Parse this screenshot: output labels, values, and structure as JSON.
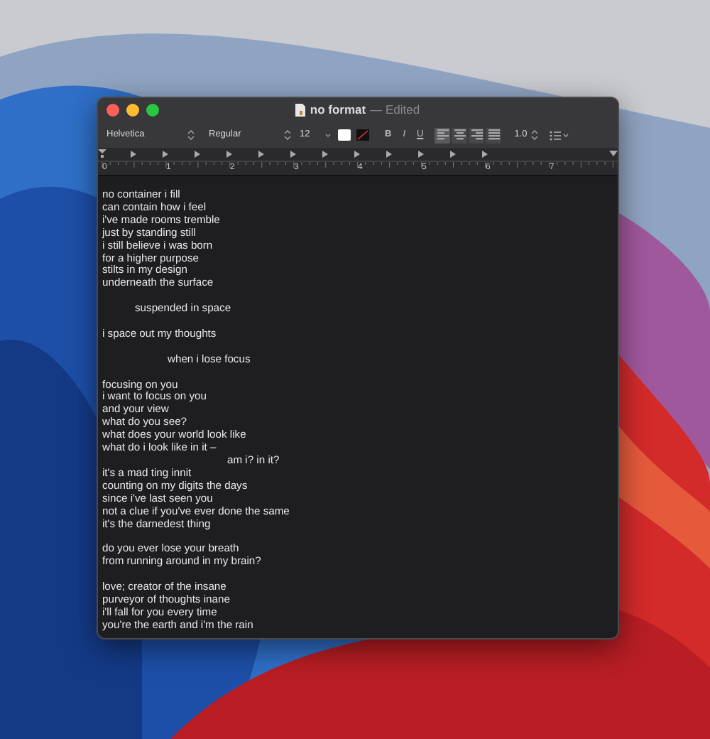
{
  "window": {
    "title": "no format",
    "status": "— Edited"
  },
  "toolbar": {
    "font": "Helvetica",
    "style": "Regular",
    "size": "12",
    "bold": "B",
    "italic": "I",
    "underline": "U",
    "alignments": [
      {
        "selected": true
      },
      {
        "selected": false
      },
      {
        "selected": false
      },
      {
        "selected": false
      }
    ],
    "spacing": "1.0"
  },
  "ruler": {
    "numbers": [
      "0",
      "1",
      "2",
      "3",
      "4",
      "5",
      "6",
      "7"
    ]
  },
  "document": {
    "stanzas": [
      {
        "lines": [
          {
            "text": "no container i fill",
            "kind": "flush"
          },
          {
            "text": "can contain how i feel",
            "kind": "flush"
          },
          {
            "text": "i've made rooms tremble",
            "kind": "flush"
          },
          {
            "text": "just by standing still",
            "kind": "flush"
          },
          {
            "text": "i still believe i was born",
            "kind": "flush"
          },
          {
            "text": "for a higher purpose",
            "kind": "flush"
          },
          {
            "text": "stilts in my design",
            "kind": "flush"
          },
          {
            "text": "underneath the surface",
            "kind": "flush"
          }
        ]
      },
      {
        "lines": [
          {
            "text": "suspended in space",
            "kind": "indent"
          }
        ]
      },
      {
        "lines": [
          {
            "text": "i space out my thoughts",
            "kind": "flush"
          }
        ]
      },
      {
        "lines": [
          {
            "text": "when i lose focus",
            "kind": "deep"
          }
        ]
      },
      {
        "lines": [
          {
            "text": "focusing on you",
            "kind": "flush"
          },
          {
            "text": "i want to focus on you",
            "kind": "flush"
          },
          {
            "text": "and your view",
            "kind": "flush"
          },
          {
            "text": "what do you see?",
            "kind": "flush"
          },
          {
            "text": "what does your world look like",
            "kind": "flush"
          },
          {
            "text": "what do i look like in it –",
            "kind": "flush"
          },
          {
            "text": "am i? in it?",
            "kind": "deeper"
          },
          {
            "text": "it's a mad ting innit",
            "kind": "flush"
          },
          {
            "text": "counting on my digits the days",
            "kind": "flush"
          },
          {
            "text": "since i've last seen you",
            "kind": "flush"
          },
          {
            "text": "not a clue if you've ever done the same",
            "kind": "flush"
          },
          {
            "text": "it's the darnedest thing",
            "kind": "flush"
          }
        ]
      },
      {
        "lines": [
          {
            "text": "do you ever lose your breath",
            "kind": "flush"
          },
          {
            "text": "from running around in my brain?",
            "kind": "flush"
          }
        ]
      },
      {
        "lines": [
          {
            "text": "love; creator of the insane",
            "kind": "flush"
          },
          {
            "text": "purveyor of thoughts inane",
            "kind": "flush"
          },
          {
            "text": "i'll fall for you every time",
            "kind": "flush"
          },
          {
            "text": "you're the earth and i'm the rain",
            "kind": "flush"
          }
        ]
      }
    ]
  }
}
